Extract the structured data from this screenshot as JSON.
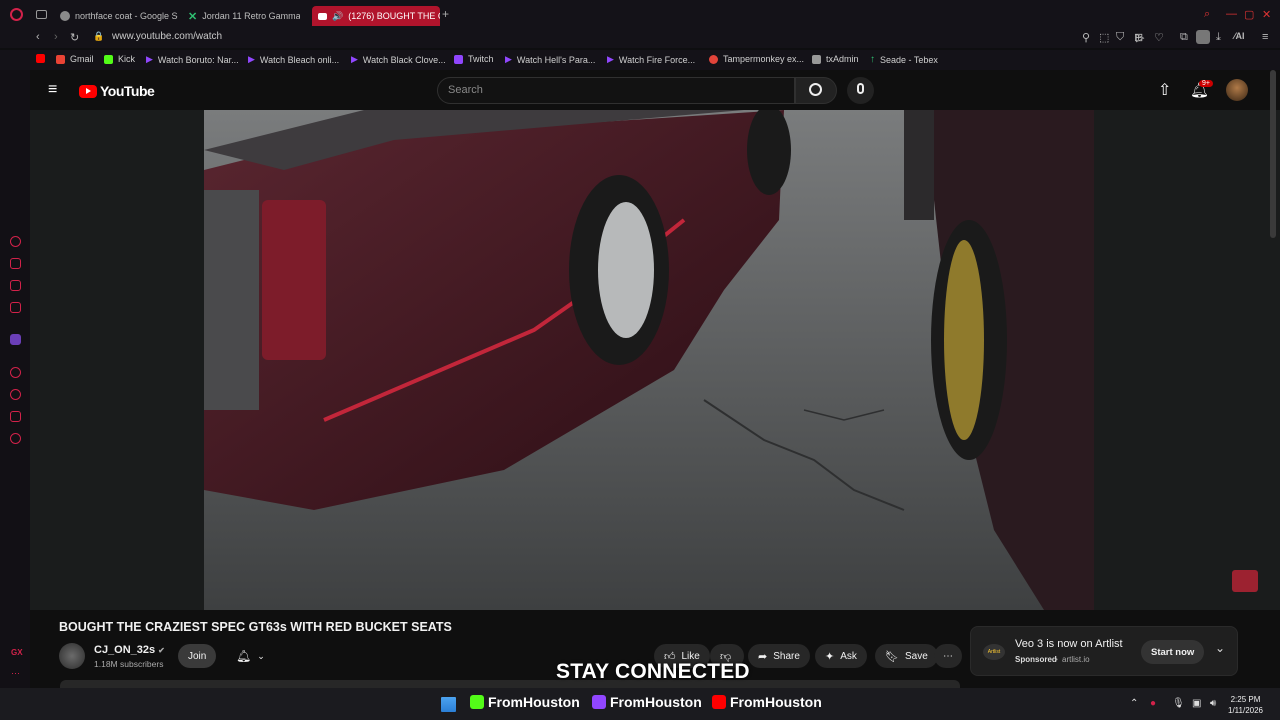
{
  "browser": {
    "tabs": [
      {
        "label": "northface coat - Google Se",
        "favicon_color": "#4285f4"
      },
      {
        "label": "Jordan 11 Retro Gamma Bl",
        "favicon_color": "#2fbf71"
      },
      {
        "label": "(1276) BOUGHT THE C",
        "favicon_color": "#ff0000",
        "active": true
      }
    ],
    "new_tab": "+",
    "address": "www.youtube.com/watch",
    "accent": "#d2224a"
  },
  "bookmarks": [
    {
      "label": "",
      "color": "#ff0000",
      "icon": "youtube-icon"
    },
    {
      "label": "Gmail",
      "color": "#ea4335",
      "icon": "gmail-icon"
    },
    {
      "label": "Kick",
      "color": "#53fc18",
      "icon": "kick-icon"
    },
    {
      "label": "Watch Boruto: Nar...",
      "color": "#9147ff",
      "icon": "play-icon"
    },
    {
      "label": "Watch Bleach onli...",
      "color": "#9147ff",
      "icon": "play-icon"
    },
    {
      "label": "Watch Black Clove...",
      "color": "#9147ff",
      "icon": "play-icon"
    },
    {
      "label": "Twitch",
      "color": "#9146ff",
      "icon": "twitch-icon"
    },
    {
      "label": "Watch Hell's Para...",
      "color": "#9147ff",
      "icon": "play-icon"
    },
    {
      "label": "Watch Fire Force...",
      "color": "#9147ff",
      "icon": "play-icon"
    },
    {
      "label": "Tampermonkey ex...",
      "color": "#e2443a",
      "icon": "tampermonkey-icon"
    },
    {
      "label": "txAdmin",
      "color": "#999999",
      "icon": "txadmin-icon"
    },
    {
      "label": "Seade - Tebex",
      "color": "#2fbf71",
      "icon": "tebex-icon"
    }
  ],
  "youtube": {
    "logo": "YouTube",
    "search_placeholder": "Search",
    "notification_count": "9+",
    "video_title": "BOUGHT THE CRAZIEST SPEC GT63s WITH RED BUCKET SEATS",
    "channel_name": "CJ_ON_32s",
    "subscribers": "1.18M subscribers",
    "join_label": "Join",
    "actions": {
      "like": "Like",
      "share": "Share",
      "ask": "Ask",
      "save": "Save",
      "more": "⋯"
    },
    "ad": {
      "brand_badge": "Artlist",
      "title": "Veo 3 is now on Artlist",
      "sponsored": "Sponsored",
      "domain": "artlist.io",
      "cta": "Start now"
    }
  },
  "overlay": {
    "stay_connected": "STAY CONNECTED",
    "promos": [
      {
        "label": "FromHouston",
        "color": "#53fc18"
      },
      {
        "label": "FromHouston",
        "color": "#9146ff"
      },
      {
        "label": "FromHouston",
        "color": "#ff0000"
      }
    ]
  },
  "taskbar": {
    "time": "2:25 PM",
    "date": "1/11/2026"
  }
}
